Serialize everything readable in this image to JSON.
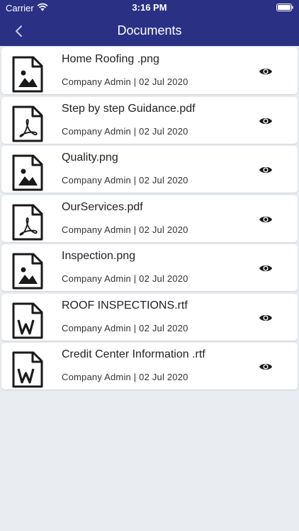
{
  "status_bar": {
    "carrier": "Carrier",
    "time": "3:16 PM"
  },
  "header": {
    "title": "Documents",
    "back_icon": "chevron-left-icon"
  },
  "colors": {
    "header_bg": "#2a3185",
    "page_bg": "#e9edf1",
    "card_bg": "#ffffff",
    "icon": "#1a1a1a"
  },
  "documents": [
    {
      "name": "Home Roofing .png",
      "meta": "Company Admin | 02 Jul 2020",
      "icon": "image-file-icon"
    },
    {
      "name": "Step by step Guidance.pdf",
      "meta": "Company Admin | 02 Jul 2020",
      "icon": "pdf-file-icon"
    },
    {
      "name": "Quality.png",
      "meta": "Company Admin | 02 Jul 2020",
      "icon": "image-file-icon"
    },
    {
      "name": "OurServices.pdf",
      "meta": "Company Admin | 02 Jul 2020",
      "icon": "pdf-file-icon"
    },
    {
      "name": "Inspection.png",
      "meta": "Company Admin | 02 Jul 2020",
      "icon": "image-file-icon"
    },
    {
      "name": "ROOF INSPECTIONS.rtf",
      "meta": "Company Admin | 02 Jul 2020",
      "icon": "word-file-icon"
    },
    {
      "name": "Credit Center Information .rtf",
      "meta": "Company Admin | 02 Jul 2020",
      "icon": "word-file-icon"
    }
  ]
}
